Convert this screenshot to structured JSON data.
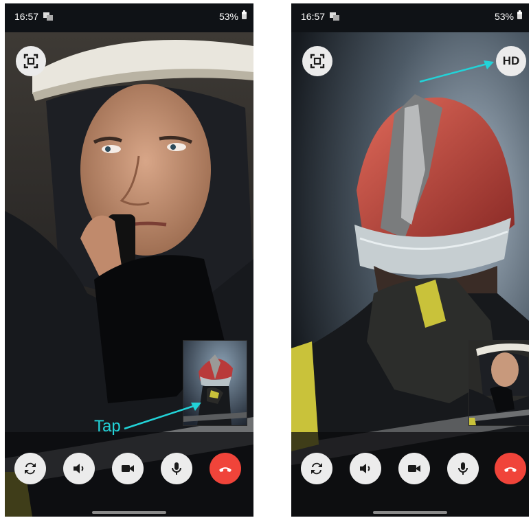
{
  "screens": [
    {
      "status": {
        "time": "16:57",
        "battery": "53%"
      },
      "annotation": {
        "label": "Tap"
      }
    },
    {
      "status": {
        "time": "16:57",
        "battery": "53%"
      },
      "hd_button": {
        "label": "HD"
      }
    }
  ],
  "controls": {
    "icons": [
      "switch-camera-icon",
      "speaker-icon",
      "video-camera-icon",
      "microphone-icon",
      "end-call-icon"
    ]
  },
  "colors": {
    "annotation": "#22d3d8",
    "end_call": "#f0443a",
    "button_bg": "#ececec",
    "helmet_red": "#b93a3a",
    "reflective_yellow": "#c9c23a"
  }
}
